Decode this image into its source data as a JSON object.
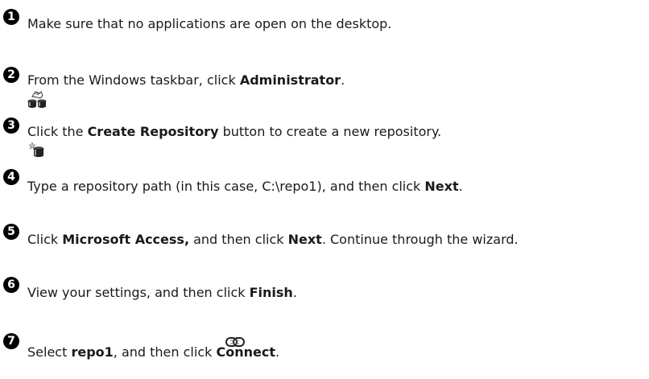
{
  "steps": [
    {
      "number": "1",
      "text": "Make sure that no applications are open on the desktop."
    },
    {
      "number": "2",
      "pre": "From the Windows taskbar, click ",
      "bold": "Administrator",
      "post": ".",
      "icon": "administrator-icon"
    },
    {
      "number": "3",
      "pre": "Click the ",
      "bold": "Create Repository",
      "post": " button to create a new repository.",
      "icon": "create-repository-icon"
    },
    {
      "number": "4",
      "pre": "Type a repository path (in this case, C:\\repo1), and then click ",
      "bold": "Next",
      "post": "."
    },
    {
      "number": "5",
      "pre": "Click ",
      "bold": "Microsoft Access,",
      "mid": " and then click ",
      "bold2": "Next",
      "post": ". Continue through the wizard."
    },
    {
      "number": "6",
      "pre": "View your settings, and then click ",
      "bold": "Finish",
      "post": "."
    },
    {
      "number": "7",
      "pre": "Select ",
      "bold": "repo1",
      "mid": ", and then click ",
      "bold2": "Connect",
      "post": ".",
      "icon": "connect-icon"
    }
  ]
}
